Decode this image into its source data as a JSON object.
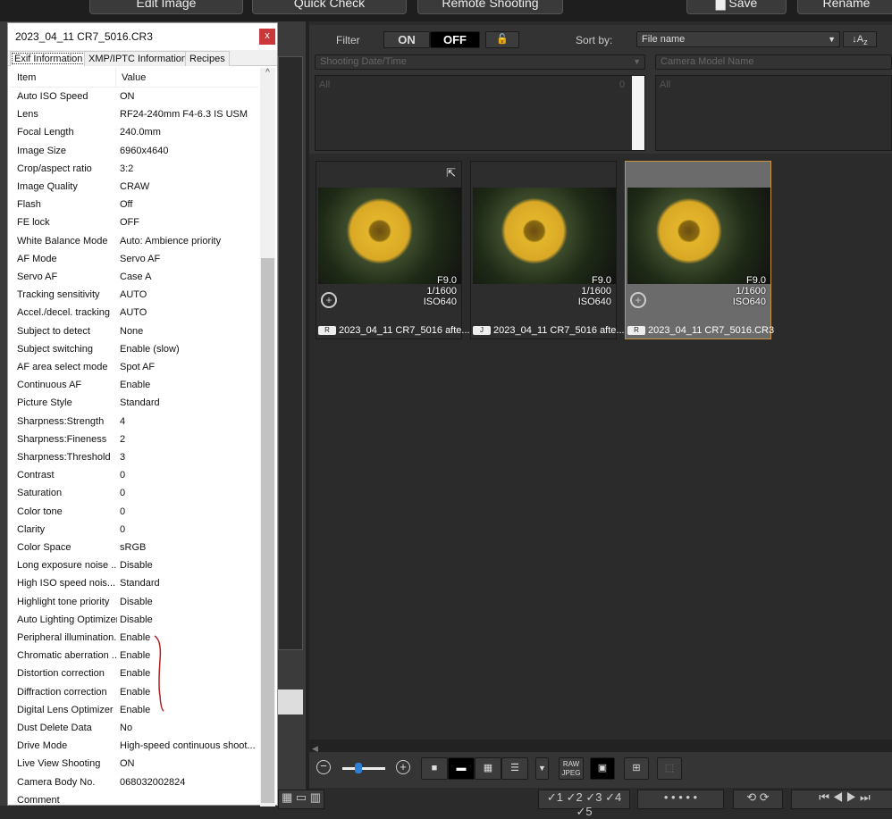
{
  "topbar": {
    "edit_image": "Edit Image",
    "quick_check": "Quick Check",
    "remote_shooting": "Remote Shooting",
    "save": "Save",
    "rename": "Rename"
  },
  "dialog": {
    "title": "2023_04_11 CR7_5016.CR3",
    "close": "x",
    "tabs": [
      "Exif Information",
      "XMP/IPTC Information",
      "Recipes"
    ],
    "columns": {
      "item": "Item",
      "value": "Value"
    },
    "rows": [
      [
        "Auto ISO Speed",
        "ON"
      ],
      [
        "Lens",
        "RF24-240mm F4-6.3 IS USM"
      ],
      [
        "Focal Length",
        "240.0mm"
      ],
      [
        "Image Size",
        "6960x4640"
      ],
      [
        "Crop/aspect ratio",
        "3:2"
      ],
      [
        "Image Quality",
        "CRAW"
      ],
      [
        "Flash",
        "Off"
      ],
      [
        "FE lock",
        "OFF"
      ],
      [
        "White Balance Mode",
        "Auto: Ambience priority"
      ],
      [
        "AF Mode",
        "Servo AF"
      ],
      [
        "Servo AF",
        "Case A"
      ],
      [
        "Tracking sensitivity",
        "AUTO"
      ],
      [
        "Accel./decel. tracking",
        "AUTO"
      ],
      [
        "Subject to detect",
        "None"
      ],
      [
        "Subject switching",
        "Enable (slow)"
      ],
      [
        "AF area select mode",
        "Spot AF"
      ],
      [
        "Continuous AF",
        "Enable"
      ],
      [
        "Picture Style",
        "Standard"
      ],
      [
        "Sharpness:Strength",
        "4"
      ],
      [
        "Sharpness:Fineness",
        "2"
      ],
      [
        "Sharpness:Threshold",
        "3"
      ],
      [
        "Contrast",
        "0"
      ],
      [
        "Saturation",
        "0"
      ],
      [
        "Color tone",
        "0"
      ],
      [
        "Clarity",
        "0"
      ],
      [
        "Color Space",
        "sRGB"
      ],
      [
        "Long exposure noise ...",
        "Disable"
      ],
      [
        "High ISO speed nois...",
        "Standard"
      ],
      [
        "Highlight tone priority",
        "Disable"
      ],
      [
        "Auto Lighting Optimizer",
        "Disable"
      ],
      [
        "Peripheral illumination...",
        "Enable"
      ],
      [
        "Chromatic aberration ...",
        "Enable"
      ],
      [
        "Distortion correction",
        "Enable"
      ],
      [
        "Diffraction correction",
        "Enable"
      ],
      [
        "Digital Lens Optimizer",
        "Enable"
      ],
      [
        "Dust Delete Data",
        "No"
      ],
      [
        "Drive Mode",
        "High-speed continuous shoot..."
      ],
      [
        "Live View Shooting",
        "ON"
      ],
      [
        "Camera Body No.",
        "068032002824"
      ],
      [
        "Comment",
        ""
      ]
    ]
  },
  "filter": {
    "label": "Filter",
    "on": "ON",
    "off": "OFF",
    "sort_label": "Sort by:",
    "sort_value": "File name",
    "date_select": "Shooting Date/Time",
    "camera_select": "Camera Model Name",
    "date_list": {
      "item": "All",
      "count": "0"
    },
    "camera_list": {
      "item": "All"
    }
  },
  "thumbnails": [
    {
      "name": "2023_04_11 CR7_5016 afte...",
      "badge": "R",
      "aperture": "F9.0",
      "shutter": "1/1600",
      "iso": "ISO640",
      "selected": false
    },
    {
      "name": "2023_04_11 CR7_5016 afte...",
      "badge": "J",
      "aperture": "F9.0",
      "shutter": "1/1600",
      "iso": "ISO640",
      "selected": false
    },
    {
      "name": "2023_04_11 CR7_5016.CR3",
      "badge": "R",
      "aperture": "F9.0",
      "shutter": "1/1600",
      "iso": "ISO640",
      "selected": true
    }
  ],
  "toolbar": {
    "raw_jpeg": "RAW JPEG",
    "zoom_level": 0.4
  },
  "checkmarks": [
    "✓1",
    "✓2",
    "✓3",
    "✓4",
    "✓5"
  ],
  "colors": {
    "accent": "#c8923e",
    "close": "#c9383a",
    "slider": "#2f7fd6"
  }
}
